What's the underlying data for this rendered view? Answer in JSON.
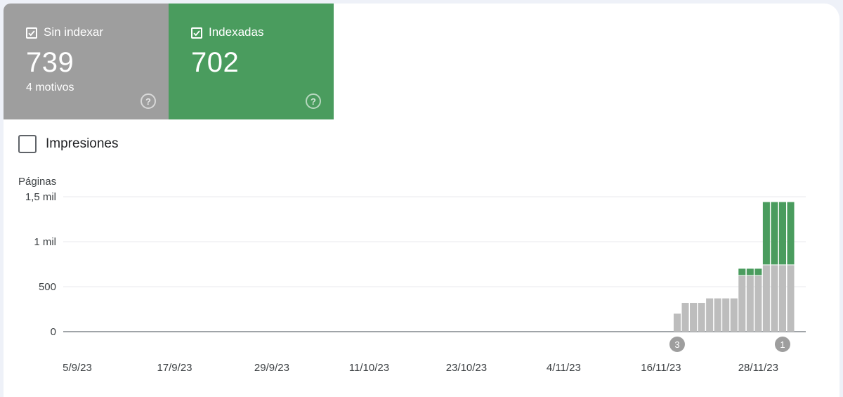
{
  "tiles": [
    {
      "label": "Sin indexar",
      "value": "739",
      "sub": "4 motivos",
      "checked": true,
      "color": "#9e9e9e"
    },
    {
      "label": "Indexadas",
      "value": "702",
      "sub": "",
      "checked": true,
      "color": "#4a9c5e"
    }
  ],
  "help_glyph": "?",
  "impressions": {
    "label": "Impresiones",
    "checked": false
  },
  "chart_data": {
    "type": "bar",
    "stacked": true,
    "ylabel": "Páginas",
    "ylim": [
      0,
      1500
    ],
    "y_ticks": [
      {
        "value": 0,
        "label": "0"
      },
      {
        "value": 500,
        "label": "500"
      },
      {
        "value": 1000,
        "label": "1 mil"
      },
      {
        "value": 1500,
        "label": "1,5 mil"
      }
    ],
    "x_start": "2023-09-05",
    "x_end": "2023-12-03",
    "x_tick_labels": [
      {
        "date": "2023-09-05",
        "label": "5/9/23"
      },
      {
        "date": "2023-09-17",
        "label": "17/9/23"
      },
      {
        "date": "2023-09-29",
        "label": "29/9/23"
      },
      {
        "date": "2023-10-11",
        "label": "11/10/23"
      },
      {
        "date": "2023-10-23",
        "label": "23/10/23"
      },
      {
        "date": "2023-11-04",
        "label": "4/11/23"
      },
      {
        "date": "2023-11-16",
        "label": "16/11/23"
      },
      {
        "date": "2023-11-28",
        "label": "28/11/23"
      }
    ],
    "series": [
      {
        "name": "Sin indexar",
        "color": "#bdbdbd"
      },
      {
        "name": "Indexadas",
        "color": "#4a9c5e"
      }
    ],
    "points": [
      {
        "date": "2023-11-18",
        "sin_indexar": 200,
        "indexadas": 0
      },
      {
        "date": "2023-11-19",
        "sin_indexar": 320,
        "indexadas": 0
      },
      {
        "date": "2023-11-20",
        "sin_indexar": 320,
        "indexadas": 0
      },
      {
        "date": "2023-11-21",
        "sin_indexar": 320,
        "indexadas": 0
      },
      {
        "date": "2023-11-22",
        "sin_indexar": 370,
        "indexadas": 0
      },
      {
        "date": "2023-11-23",
        "sin_indexar": 370,
        "indexadas": 0
      },
      {
        "date": "2023-11-24",
        "sin_indexar": 370,
        "indexadas": 0
      },
      {
        "date": "2023-11-25",
        "sin_indexar": 370,
        "indexadas": 0
      },
      {
        "date": "2023-11-26",
        "sin_indexar": 620,
        "indexadas": 80
      },
      {
        "date": "2023-11-27",
        "sin_indexar": 620,
        "indexadas": 80
      },
      {
        "date": "2023-11-28",
        "sin_indexar": 620,
        "indexadas": 80
      },
      {
        "date": "2023-11-29",
        "sin_indexar": 739,
        "indexadas": 702
      },
      {
        "date": "2023-11-30",
        "sin_indexar": 739,
        "indexadas": 702
      },
      {
        "date": "2023-12-01",
        "sin_indexar": 739,
        "indexadas": 702
      },
      {
        "date": "2023-12-02",
        "sin_indexar": 739,
        "indexadas": 702
      }
    ],
    "annotations": [
      {
        "date": "2023-11-18",
        "label": "3"
      },
      {
        "date": "2023-12-01",
        "label": "1"
      }
    ],
    "grid": true
  }
}
